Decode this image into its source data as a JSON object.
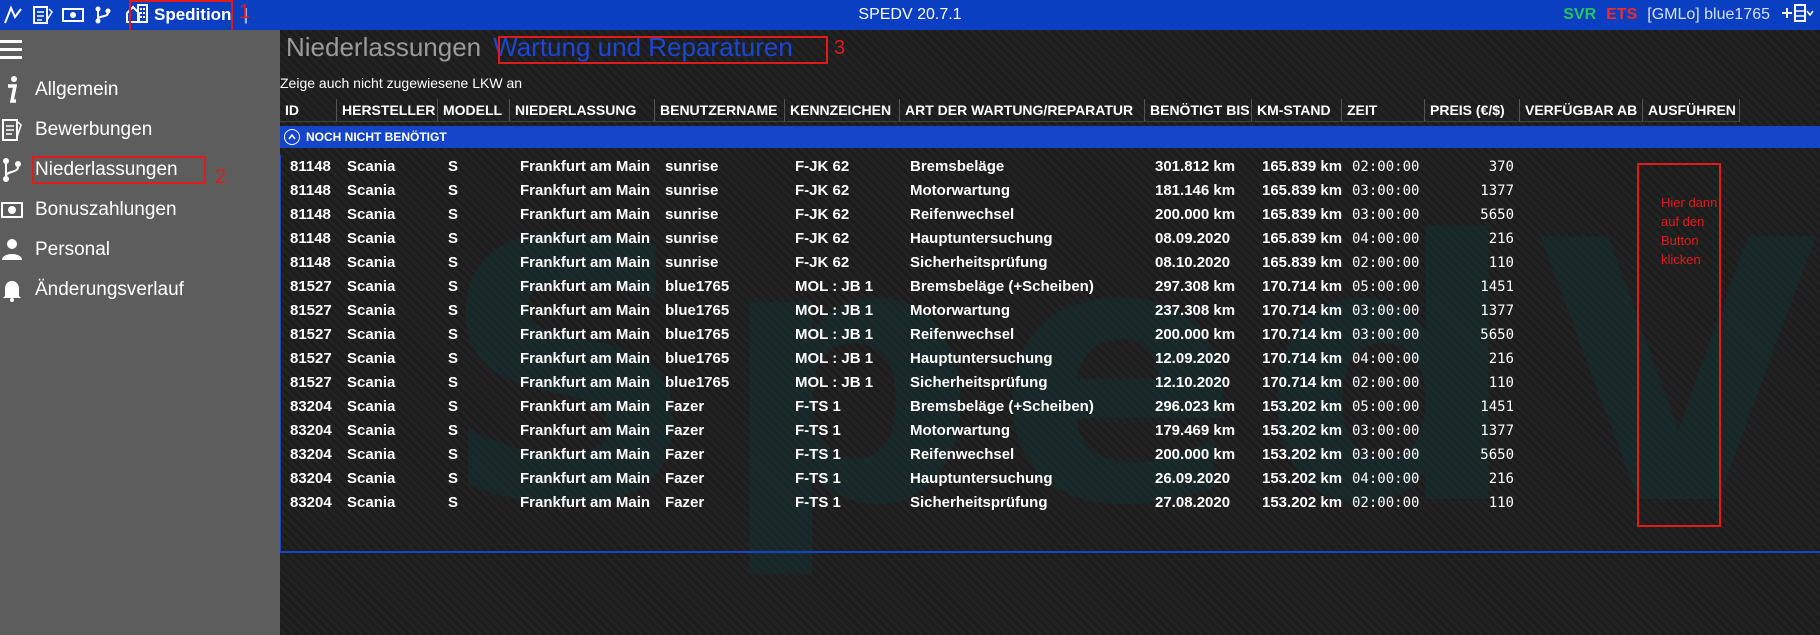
{
  "topbar": {
    "app_title": "SPEDV 20.7.1",
    "brand_label": "Spedition",
    "separator": "|",
    "svr": "SVR",
    "ets": "ETS",
    "user": "[GMLo] blue1765",
    "colors": {
      "bar": "#0b3fc2",
      "svr": "#22c55e",
      "ets": "#ef2b2b"
    }
  },
  "annotations": {
    "n1": "1",
    "n2": "2",
    "n3": "3",
    "note": "Hier dann auf den Button klicken"
  },
  "sidebar": {
    "items": [
      {
        "label": "Allgemein",
        "icon": "info-icon"
      },
      {
        "label": "Bewerbungen",
        "icon": "documents-icon"
      },
      {
        "label": "Niederlassungen",
        "icon": "branch-icon"
      },
      {
        "label": "Bonuszahlungen",
        "icon": "money-icon"
      },
      {
        "label": "Personal",
        "icon": "person-icon"
      },
      {
        "label": "Änderungsverlauf",
        "icon": "bell-icon"
      }
    ]
  },
  "main": {
    "breadcrumb_parent": "Niederlassungen",
    "breadcrumb_current": "Wartung und Reparaturen",
    "checkbox_label": "Zeige auch nicht zugewiesene LKW an",
    "group_label": "NOCH NICHT BENÖTIGT",
    "columns": [
      "ID",
      "HERSTELLER",
      "MODELL",
      "NIEDERLASSUNG",
      "BENUTZERNAME",
      "KENNZEICHEN",
      "ART DER WARTUNG/REPARATUR",
      "BENÖTIGT BIS",
      "KM-STAND",
      "ZEIT",
      "PREIS (€/$)",
      "VERFÜGBAR AB",
      "AUSFÜHREN"
    ],
    "rows": [
      [
        "81148",
        "Scania",
        "S",
        "Frankfurt am Main",
        "sunrise",
        "F-JK 62",
        "Bremsbeläge",
        "301.812 km",
        "165.839 km",
        "02:00:00",
        "370"
      ],
      [
        "81148",
        "Scania",
        "S",
        "Frankfurt am Main",
        "sunrise",
        "F-JK 62",
        "Motorwartung",
        "181.146 km",
        "165.839 km",
        "03:00:00",
        "1377"
      ],
      [
        "81148",
        "Scania",
        "S",
        "Frankfurt am Main",
        "sunrise",
        "F-JK 62",
        "Reifenwechsel",
        "200.000 km",
        "165.839 km",
        "03:00:00",
        "5650"
      ],
      [
        "81148",
        "Scania",
        "S",
        "Frankfurt am Main",
        "sunrise",
        "F-JK 62",
        "Hauptuntersuchung",
        "08.09.2020",
        "165.839 km",
        "04:00:00",
        "216"
      ],
      [
        "81148",
        "Scania",
        "S",
        "Frankfurt am Main",
        "sunrise",
        "F-JK 62",
        "Sicherheitsprüfung",
        "08.10.2020",
        "165.839 km",
        "02:00:00",
        "110"
      ],
      [
        "81527",
        "Scania",
        "S",
        "Frankfurt am Main",
        "blue1765",
        "MOL : JB 1",
        "Bremsbeläge (+Scheiben)",
        "297.308 km",
        "170.714 km",
        "05:00:00",
        "1451"
      ],
      [
        "81527",
        "Scania",
        "S",
        "Frankfurt am Main",
        "blue1765",
        "MOL : JB 1",
        "Motorwartung",
        "237.308 km",
        "170.714 km",
        "03:00:00",
        "1377"
      ],
      [
        "81527",
        "Scania",
        "S",
        "Frankfurt am Main",
        "blue1765",
        "MOL : JB 1",
        "Reifenwechsel",
        "200.000 km",
        "170.714 km",
        "03:00:00",
        "5650"
      ],
      [
        "81527",
        "Scania",
        "S",
        "Frankfurt am Main",
        "blue1765",
        "MOL : JB 1",
        "Hauptuntersuchung",
        "12.09.2020",
        "170.714 km",
        "04:00:00",
        "216"
      ],
      [
        "81527",
        "Scania",
        "S",
        "Frankfurt am Main",
        "blue1765",
        "MOL : JB 1",
        "Sicherheitsprüfung",
        "12.10.2020",
        "170.714 km",
        "02:00:00",
        "110"
      ],
      [
        "83204",
        "Scania",
        "S",
        "Frankfurt am Main",
        "Fazer",
        "F-TS 1",
        "Bremsbeläge (+Scheiben)",
        "296.023 km",
        "153.202 km",
        "05:00:00",
        "1451"
      ],
      [
        "83204",
        "Scania",
        "S",
        "Frankfurt am Main",
        "Fazer",
        "F-TS 1",
        "Motorwartung",
        "179.469 km",
        "153.202 km",
        "03:00:00",
        "1377"
      ],
      [
        "83204",
        "Scania",
        "S",
        "Frankfurt am Main",
        "Fazer",
        "F-TS 1",
        "Reifenwechsel",
        "200.000 km",
        "153.202 km",
        "03:00:00",
        "5650"
      ],
      [
        "83204",
        "Scania",
        "S",
        "Frankfurt am Main",
        "Fazer",
        "F-TS 1",
        "Hauptuntersuchung",
        "26.09.2020",
        "153.202 km",
        "04:00:00",
        "216"
      ],
      [
        "83204",
        "Scania",
        "S",
        "Frankfurt am Main",
        "Fazer",
        "F-TS 1",
        "Sicherheitsprüfung",
        "27.08.2020",
        "153.202 km",
        "02:00:00",
        "110"
      ]
    ]
  }
}
